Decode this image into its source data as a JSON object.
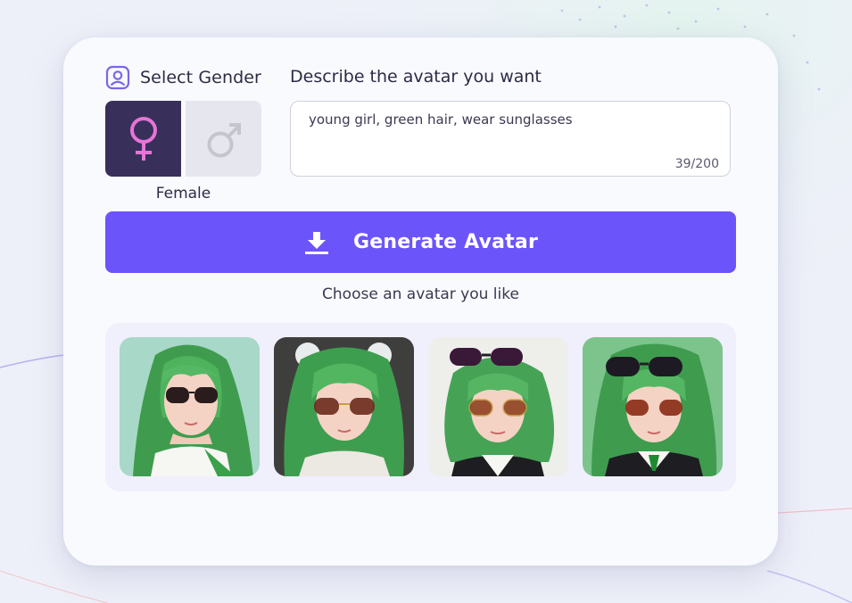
{
  "gender": {
    "title": "Select Gender",
    "icon": "user-portrait-icon",
    "options": [
      {
        "id": "female",
        "icon": "female-symbol-icon",
        "selected": true
      },
      {
        "id": "male",
        "icon": "male-symbol-icon",
        "selected": false
      }
    ],
    "selected_label": "Female"
  },
  "description": {
    "title": "Describe the avatar you want",
    "value": "young girl, green hair, wear sunglasses",
    "counter": "39/200"
  },
  "generate": {
    "label": "Generate Avatar",
    "icon": "download-icon"
  },
  "results": {
    "title": "Choose an avatar you like",
    "avatars": [
      {
        "name": "avatar-1",
        "background": "#a8d8c8"
      },
      {
        "name": "avatar-2",
        "background": "#3e3f3c"
      },
      {
        "name": "avatar-3",
        "background": "#eeeeea"
      },
      {
        "name": "avatar-4",
        "background": "#7cc48c"
      }
    ]
  },
  "colors": {
    "accent": "#6c54fb",
    "female_selected_bg": "#38305a",
    "female_symbol": "#e675d6",
    "male_symbol": "#c4c5cf"
  }
}
